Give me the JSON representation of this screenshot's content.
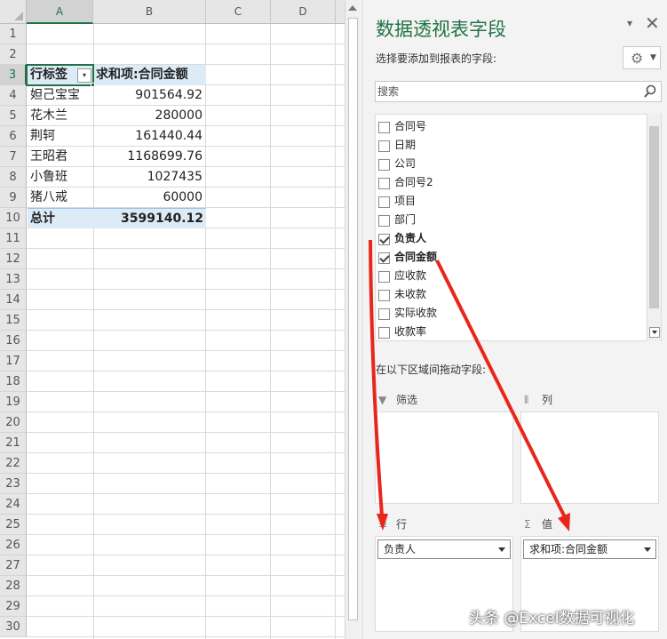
{
  "sheet": {
    "columns": [
      "A",
      "B",
      "C",
      "D"
    ],
    "rows": [
      "1",
      "2",
      "3",
      "4",
      "5",
      "6",
      "7",
      "8",
      "9",
      "10",
      "11",
      "12",
      "13",
      "14",
      "15",
      "16",
      "17",
      "18",
      "19",
      "20",
      "21",
      "22",
      "23",
      "24",
      "25",
      "26",
      "27",
      "28",
      "29",
      "30"
    ],
    "pivot": {
      "header_row_label": "行标签",
      "header_value_label": "求和项:合同金额",
      "rows": [
        {
          "name": "妲己宝宝",
          "value": "901564.92"
        },
        {
          "name": "花木兰",
          "value": "280000"
        },
        {
          "name": "荆轲",
          "value": "161440.44"
        },
        {
          "name": "王昭君",
          "value": "1168699.76"
        },
        {
          "name": "小鲁班",
          "value": "1027435"
        },
        {
          "name": "猪八戒",
          "value": "60000"
        }
      ],
      "total_label": "总计",
      "total_value": "3599140.12"
    }
  },
  "pane": {
    "title": "数据透视表字段",
    "subtitle": "选择要添加到报表的字段:",
    "search_placeholder": "搜索",
    "fields": [
      {
        "label": "合同号",
        "checked": false
      },
      {
        "label": "日期",
        "checked": false
      },
      {
        "label": "公司",
        "checked": false
      },
      {
        "label": "合同号2",
        "checked": false
      },
      {
        "label": "项目",
        "checked": false
      },
      {
        "label": "部门",
        "checked": false
      },
      {
        "label": "负责人",
        "checked": true
      },
      {
        "label": "合同金额",
        "checked": true
      },
      {
        "label": "应收款",
        "checked": false
      },
      {
        "label": "未收款",
        "checked": false
      },
      {
        "label": "实际收款",
        "checked": false
      },
      {
        "label": "收款率",
        "checked": false
      }
    ],
    "drag_label": "在以下区域间拖动字段:",
    "areas": {
      "filter": "筛选",
      "columns": "列",
      "rows": "行",
      "values": "值"
    },
    "rows_chip": "负责人",
    "values_chip": "求和项:合同金额"
  },
  "watermark": "头条 @Excel数据可视化",
  "colors": {
    "accent": "#217346",
    "pivot_fill": "#ddebf7",
    "arrow": "#e8261c"
  }
}
